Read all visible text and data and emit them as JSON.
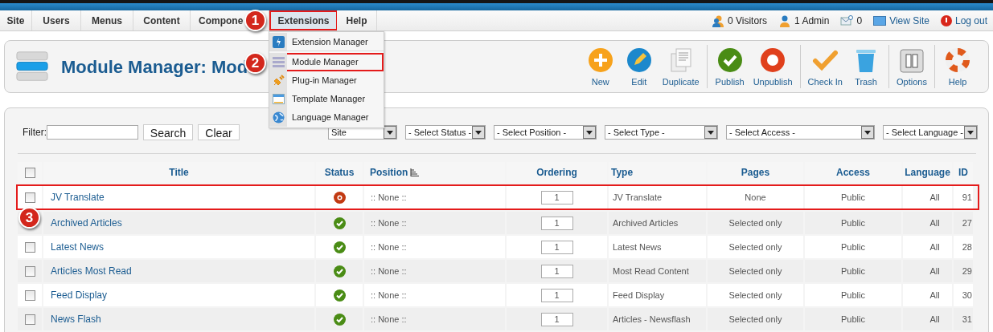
{
  "top_menu": {
    "tabs": [
      {
        "label": "Site",
        "selected": false
      },
      {
        "label": "Users",
        "selected": false
      },
      {
        "label": "Menus",
        "selected": false
      },
      {
        "label": "Content",
        "selected": false
      },
      {
        "label": "Compone",
        "selected": false
      },
      {
        "label": "Extensions",
        "selected": true
      },
      {
        "label": "Help",
        "selected": false
      }
    ],
    "status": [
      {
        "label": "0 Visitors",
        "kind": "text"
      },
      {
        "label": "1 Admin",
        "kind": "text"
      },
      {
        "label": "0",
        "kind": "text"
      },
      {
        "label": "View Site",
        "kind": "link"
      },
      {
        "label": "Log out",
        "kind": "link"
      }
    ]
  },
  "extensions_menu": {
    "items": [
      {
        "label": "Extension Manager",
        "selected": false
      },
      {
        "label": "Module Manager",
        "selected": true
      },
      {
        "label": "Plug-in Manager",
        "selected": false
      },
      {
        "label": "Template Manager",
        "selected": false
      },
      {
        "label": "Language Manager",
        "selected": false
      }
    ]
  },
  "page_title": "Module Manager: Mod",
  "toolbar": {
    "groups": [
      [
        "New",
        "Edit",
        "Duplicate"
      ],
      [
        "Publish",
        "Unpublish"
      ],
      [
        "Check In",
        "Trash"
      ],
      [
        "Options"
      ],
      [
        "Help"
      ]
    ]
  },
  "filter": {
    "label": "Filter:",
    "search_button": "Search",
    "clear_button": "Clear",
    "selects": [
      "Site",
      "- Select Status -",
      "- Select Position -",
      "- Select Type -",
      "- Select Access -",
      "- Select Language -"
    ]
  },
  "table": {
    "header_checked": false,
    "columns": [
      "Title",
      "Status",
      "Position",
      "Ordering",
      "Type",
      "Pages",
      "Access",
      "Language",
      "ID"
    ],
    "rows": [
      {
        "title": "JV Translate",
        "published": false,
        "position": ":: None ::",
        "ordering": "1",
        "type": "JV Translate",
        "pages": "None",
        "access": "Public",
        "language": "All",
        "id": "91",
        "checked": false,
        "outlined": true
      },
      {
        "title": "Archived Articles",
        "published": true,
        "position": ":: None ::",
        "ordering": "1",
        "type": "Archived Articles",
        "pages": "Selected only",
        "access": "Public",
        "language": "All",
        "id": "27",
        "outlined": false
      },
      {
        "title": "Latest News",
        "published": true,
        "position": ":: None ::",
        "ordering": "1",
        "type": "Latest News",
        "pages": "Selected only",
        "access": "Public",
        "language": "All",
        "id": "28",
        "checked": false,
        "outlined": false
      },
      {
        "title": "Articles Most Read",
        "published": true,
        "position": ":: None ::",
        "ordering": "1",
        "type": "Most Read Content",
        "pages": "Selected only",
        "access": "Public",
        "language": "All",
        "id": "29",
        "checked": false,
        "outlined": false
      },
      {
        "title": "Feed Display",
        "published": true,
        "position": ":: None ::",
        "ordering": "1",
        "type": "Feed Display",
        "pages": "Selected only",
        "access": "Public",
        "language": "All",
        "id": "30",
        "checked": false,
        "outlined": false
      },
      {
        "title": "News Flash",
        "published": true,
        "position": ":: None ::",
        "ordering": "1",
        "type": "Articles - Newsflash",
        "pages": "Selected only",
        "access": "Public",
        "language": "All",
        "id": "31",
        "checked": false,
        "outlined": false
      }
    ]
  },
  "step_markers": [
    "1",
    "2",
    "3"
  ]
}
